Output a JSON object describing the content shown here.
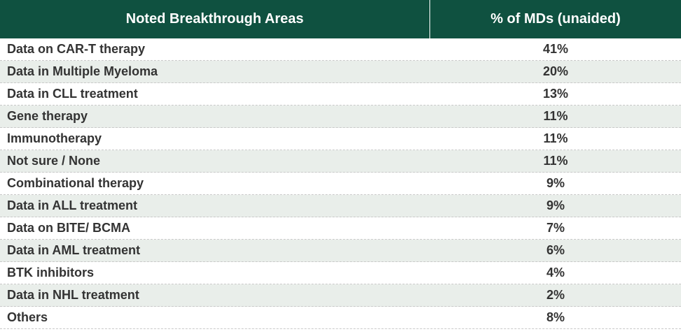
{
  "chart_data": {
    "type": "table",
    "columns": [
      "Noted Breakthrough Areas",
      "% of MDs (unaided)"
    ],
    "rows": [
      {
        "label": "Data on CAR-T therapy",
        "value": "41%"
      },
      {
        "label": "Data in Multiple Myeloma",
        "value": "20%"
      },
      {
        "label": "Data in CLL treatment",
        "value": "13%"
      },
      {
        "label": "Gene therapy",
        "value": "11%"
      },
      {
        "label": "Immunotherapy",
        "value": "11%"
      },
      {
        "label": "Not sure / None",
        "value": "11%"
      },
      {
        "label": "Combinational therapy",
        "value": "9%"
      },
      {
        "label": "Data in ALL treatment",
        "value": "9%"
      },
      {
        "label": "Data on BITE/ BCMA",
        "value": "7%"
      },
      {
        "label": "Data in AML treatment",
        "value": "6%"
      },
      {
        "label": "BTK inhibitors",
        "value": "4%"
      },
      {
        "label": "Data in NHL treatment",
        "value": "2%"
      },
      {
        "label": "Others",
        "value": "8%"
      }
    ]
  },
  "colors": {
    "header_background": "#0f5140",
    "header_text": "#ffffff",
    "row_alt_background": "#e9eeea",
    "body_text": "#333333"
  }
}
